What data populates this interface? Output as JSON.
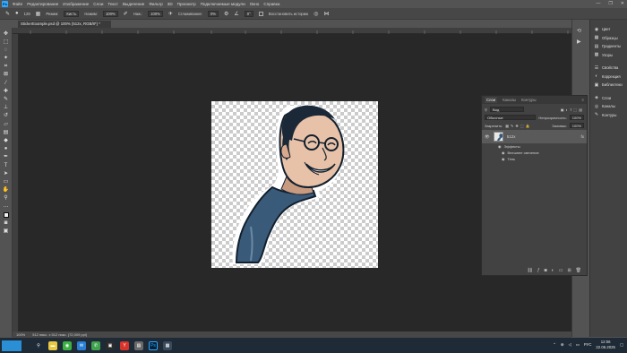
{
  "menu": {
    "items": [
      "Файл",
      "Редактирование",
      "Изображение",
      "Слои",
      "Текст",
      "Выделение",
      "Фильтр",
      "3D",
      "Просмотр",
      "Подключаемые модули",
      "Окно",
      "Справка"
    ],
    "window_controls": [
      "—",
      "❐",
      "✕"
    ]
  },
  "options_bar": {
    "brush_size": "128",
    "mode_label": "Режим:",
    "mode_value": "Кисть",
    "pressure_label": "Нажим:",
    "pressure_value": "100%",
    "flow_label": "Наж.:",
    "flow_value": "100%",
    "smoothing_label": "Сглаживание:",
    "smoothing_value": "0%",
    "angle_value": "0°",
    "history_label": "Восстановить историю"
  },
  "document": {
    "tab_title": "StickerExample.psd @ 100% (512x, RGB/8*) *"
  },
  "status_bar": {
    "zoom": "100%",
    "doc_info": "512 пикс. x 512 пикс. (72,009 ppi)"
  },
  "right_panels": {
    "items": [
      {
        "label": "Цвет",
        "icon": "color-wheel-icon"
      },
      {
        "label": "Образцы",
        "icon": "swatches-icon"
      },
      {
        "label": "Градиенты",
        "icon": "gradient-icon"
      },
      {
        "label": "Узоры",
        "icon": "patterns-icon"
      },
      {
        "label": "Свойства",
        "icon": "properties-icon"
      },
      {
        "label": "Коррекция",
        "icon": "adjustments-icon"
      },
      {
        "label": "Библиотеки",
        "icon": "libraries-icon"
      },
      {
        "label": "Слои",
        "icon": "layers-icon"
      },
      {
        "label": "Каналы",
        "icon": "channels-icon"
      },
      {
        "label": "Контуры",
        "icon": "paths-icon"
      }
    ]
  },
  "layers_panel": {
    "tabs": [
      "Слои",
      "Каналы",
      "Контуры"
    ],
    "filter_label": "Вид",
    "blend_mode": "Обычные",
    "opacity_label": "Непрозрачность:",
    "opacity_value": "100%",
    "lock_label": "Закрепить:",
    "fill_label": "Заливка:",
    "fill_value": "100%",
    "layer_name": "512x",
    "fx_badge": "fx",
    "effects_label": "Эффекты",
    "effect_1": "Внешнее свечение",
    "effect_2": "Тень"
  },
  "taskbar": {
    "language": "РУС",
    "time": "12:06",
    "date": "22.06.2025"
  },
  "colors": {
    "workspace_bg": "#282828",
    "ui_gray": "#535353",
    "panel_gray": "#424242",
    "ps_accent": "#31a8ff",
    "sticker_sweater": "#3a5a7a",
    "taskbar": "#1e2a36"
  }
}
